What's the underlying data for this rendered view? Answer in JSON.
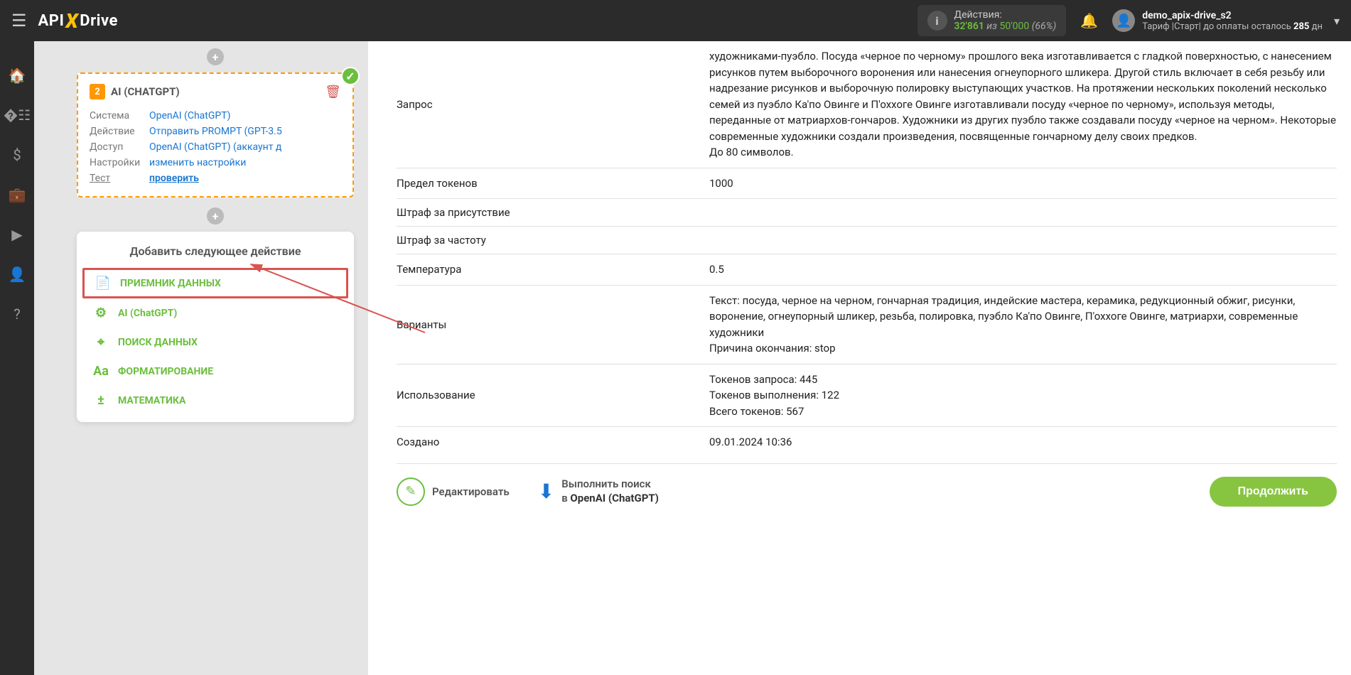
{
  "header": {
    "logo_api": "API",
    "logo_drive": "Drive",
    "actions_label": "Действия:",
    "actions_current": "32'861",
    "actions_of": " из ",
    "actions_total": "50'000",
    "actions_pct": " (66%)",
    "user_name": "demo_apix-drive_s2",
    "tariff_prefix": "Тариф |Старт| до оплаты осталось ",
    "tariff_days": "285",
    "tariff_suffix": " дн"
  },
  "step": {
    "num": "2",
    "title": "AI (CHATGPT)",
    "rows": {
      "system_lbl": "Система",
      "system_val": "OpenAI (ChatGPT)",
      "action_lbl": "Действие",
      "action_val": "Отправить PROMPT (GPT-3.5",
      "access_lbl": "Доступ",
      "access_val": "OpenAI (ChatGPT) (аккаунт д",
      "settings_lbl": "Настройки",
      "settings_val": "изменить настройки",
      "test_lbl": "Тест",
      "test_val": "проверить"
    }
  },
  "next": {
    "title": "Добавить следующее действие",
    "items": {
      "receiver": "ПРИЕМНИК ДАННЫХ",
      "ai": "AI (ChatGPT)",
      "search": "ПОИСК ДАННЫХ",
      "format": "ФОРМАТИРОВАНИЕ",
      "math": "МАТЕМАТИКА"
    }
  },
  "fields": {
    "request_lbl": "Запрос",
    "request_val": "художниками-пуэбло. Посуда «черное по черному» прошлого века изготавливается с гладкой поверхностью, с нанесением рисунков путем выборочного воронения или нанесения огнеупорного шликера. Другой стиль включает в себя резьбу или надрезание рисунков и выборочную полировку выступающих участков. На протяжении нескольких поколений несколько семей из пуэбло Ка'по Овинге и П'оххоге Овинге изготавливали посуду «черное по черному», используя методы, переданные от матриархов-гончаров. Художники из других пуэбло также создавали посуду «черное на черном». Некоторые современные художники создали произведения, посвященные гончарному делу своих предков.",
    "request_note": "До 80 символов.",
    "tokens_lbl": "Предел токенов",
    "tokens_val": "1000",
    "presence_lbl": "Штраф за присутствие",
    "freq_lbl": "Штраф за частоту",
    "temp_lbl": "Температура",
    "temp_val": "0.5",
    "variants_lbl": "Варианты",
    "variants_val": "Текст: посуда, черное на черном, гончарная традиция, индейские мастера, керамика, редукционный обжиг, рисунки, воронение, огнеупорный шликер, резьба, полировка, пуэбло Ка'по Овинге, П'оххоге Овинге, матриархи, современные художники",
    "variants_reason": "Причина окончания: stop",
    "usage_lbl": "Использование",
    "usage_req": "Токенов запроса: 445",
    "usage_comp": "Токенов выполнения: 122",
    "usage_total": "Всего токенов: 567",
    "created_lbl": "Создано",
    "created_val": "09.01.2024 10:36"
  },
  "footer": {
    "edit": "Редактировать",
    "search_line1": "Выполнить поиск",
    "search_line2_prefix": "в ",
    "search_line2_bold": "OpenAI (ChatGPT)",
    "continue": "Продолжить"
  }
}
